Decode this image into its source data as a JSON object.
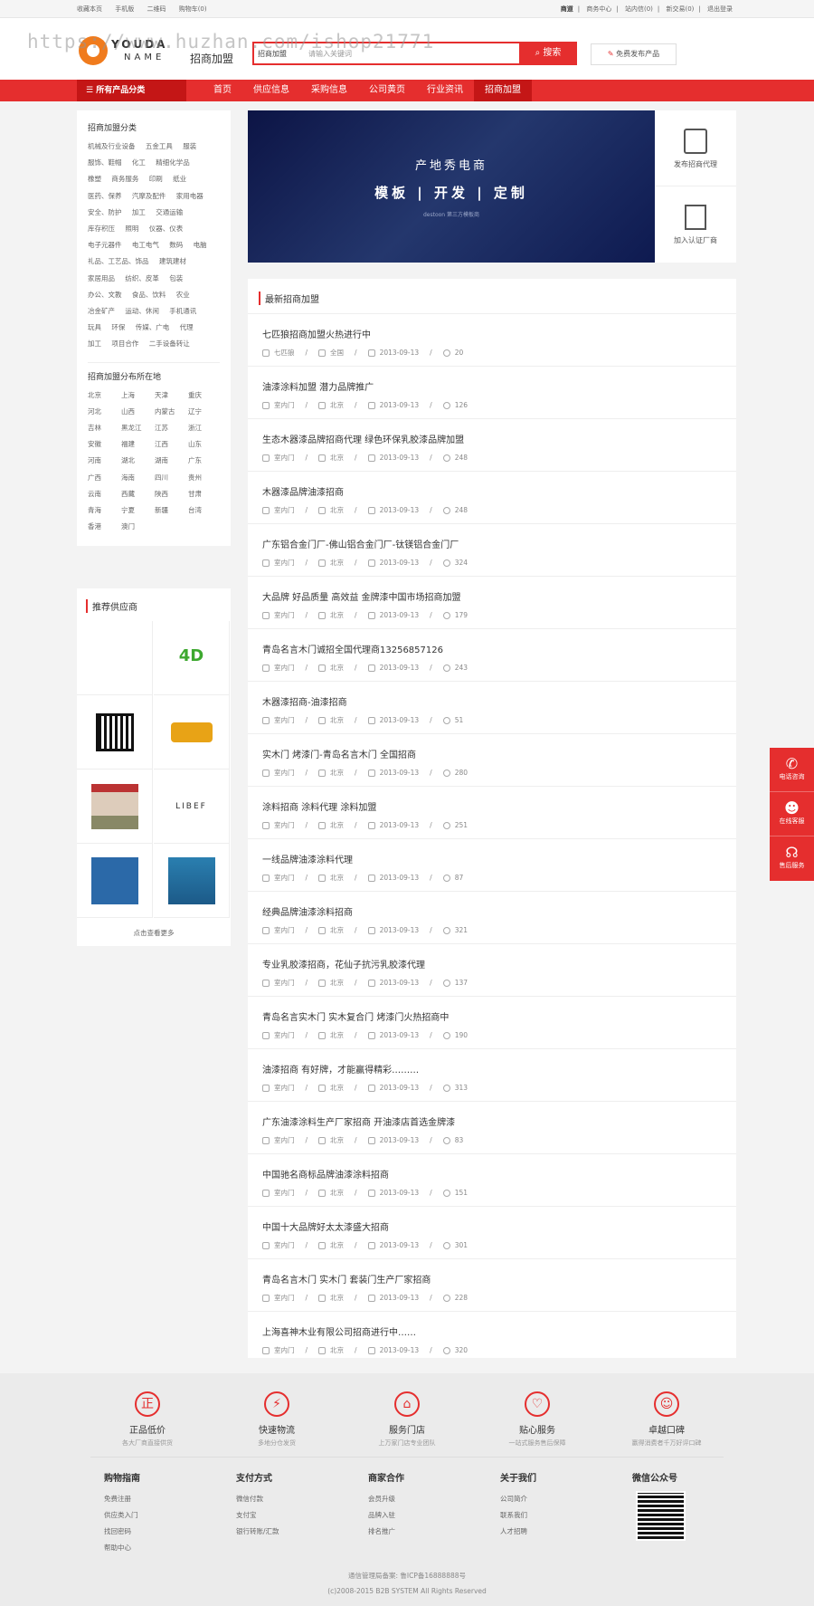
{
  "topbar": {
    "left": [
      "收藏本页",
      "手机版",
      "二维码",
      "购物车(0)"
    ],
    "right": [
      "商道",
      "商务中心",
      "站内信(0)",
      "新交易(0)",
      "退出登录"
    ]
  },
  "logo": {
    "line1": "YOUDA",
    "line2": "NAME"
  },
  "brand": "招商加盟",
  "search": {
    "category": "招商加盟",
    "placeholder": "请输入关键词",
    "button": "搜索"
  },
  "publish_button": "免费发布产品",
  "watermark": "https://www.huzhan.com/ishop21771",
  "nav": {
    "all_categories": "所有产品分类",
    "items": [
      "首页",
      "供应信息",
      "采购信息",
      "公司黄页",
      "行业资讯",
      "招商加盟"
    ],
    "active": "招商加盟"
  },
  "sidebar": {
    "categories_title": "招商加盟分类",
    "categories": [
      "机械及行业设备",
      "五金工具",
      "服装",
      "服饰、鞋帽",
      "化工",
      "精细化学品",
      "橡塑",
      "商务服务",
      "印刷",
      "纸业",
      "医药、保养",
      "汽摩及配件",
      "家用电器",
      "安全、防护",
      "加工",
      "交通运输",
      "库存积压",
      "照明",
      "仪器、仪表",
      "电子元器件",
      "电工电气",
      "数码",
      "电脑",
      "礼品、工艺品、饰品",
      "建筑建材",
      "家居用品",
      "纺织、皮革",
      "包装",
      "办公、文教",
      "食品、饮料",
      "农业",
      "冶金矿产",
      "运动、休闲",
      "手机通讯",
      "玩具",
      "环保",
      "传媒、广电",
      "代理",
      "加工",
      "项目合作",
      "二手设备转让"
    ],
    "regions_title": "招商加盟分布所在地",
    "regions": [
      "北京",
      "上海",
      "天津",
      "重庆",
      "河北",
      "山西",
      "内蒙古",
      "辽宁",
      "吉林",
      "黑龙江",
      "江苏",
      "浙江",
      "安徽",
      "福建",
      "江西",
      "山东",
      "河南",
      "湖北",
      "湖南",
      "广东",
      "广西",
      "海南",
      "四川",
      "贵州",
      "云南",
      "西藏",
      "陕西",
      "甘肃",
      "青海",
      "宁夏",
      "新疆",
      "台湾",
      "香港",
      "澳门"
    ]
  },
  "suppliers": {
    "title": "推荐供应商",
    "logo_texts": [
      "LIBEF"
    ],
    "more": "点击查看更多"
  },
  "banner": {
    "line1": "产地秀电商",
    "line2": "模板 | 开发 | 定制",
    "line3": "destoon 第三方模板商"
  },
  "banner_side": [
    "发布招商代理",
    "加入认证厂商"
  ],
  "list": {
    "title": "最新招商加盟",
    "items": [
      {
        "title": "七匹狼招商加盟火热进行中",
        "cat": "七匹狼",
        "area": "全国",
        "date": "2013-09-13",
        "views": "20"
      },
      {
        "title": "油漆涂料加盟 潜力品牌推广",
        "cat": "室内门",
        "area": "北京",
        "date": "2013-09-13",
        "views": "126"
      },
      {
        "title": "生态木器漆品牌招商代理 绿色环保乳胶漆品牌加盟",
        "cat": "室内门",
        "area": "北京",
        "date": "2013-09-13",
        "views": "248"
      },
      {
        "title": "木器漆品牌油漆招商",
        "cat": "室内门",
        "area": "北京",
        "date": "2013-09-13",
        "views": "248"
      },
      {
        "title": "广东铝合金门厂-佛山铝合金门厂-钛镁铝合金门厂",
        "cat": "室内门",
        "area": "北京",
        "date": "2013-09-13",
        "views": "324"
      },
      {
        "title": "大品牌 好品质量 高效益 金牌漆中国市场招商加盟",
        "cat": "室内门",
        "area": "北京",
        "date": "2013-09-13",
        "views": "179"
      },
      {
        "title": "青岛名言木门诚招全国代理商13256857126",
        "cat": "室内门",
        "area": "北京",
        "date": "2013-09-13",
        "views": "243"
      },
      {
        "title": "木器漆招商-油漆招商",
        "cat": "室内门",
        "area": "北京",
        "date": "2013-09-13",
        "views": "51"
      },
      {
        "title": "实木门 烤漆门-青岛名言木门 全国招商",
        "cat": "室内门",
        "area": "北京",
        "date": "2013-09-13",
        "views": "280"
      },
      {
        "title": "涂料招商 涂料代理 涂料加盟",
        "cat": "室内门",
        "area": "北京",
        "date": "2013-09-13",
        "views": "251"
      },
      {
        "title": "一线品牌油漆涂料代理",
        "cat": "室内门",
        "area": "北京",
        "date": "2013-09-13",
        "views": "87"
      },
      {
        "title": "经典品牌油漆涂料招商",
        "cat": "室内门",
        "area": "北京",
        "date": "2013-09-13",
        "views": "321"
      },
      {
        "title": "专业乳胶漆招商，花仙子抗污乳胶漆代理",
        "cat": "室内门",
        "area": "北京",
        "date": "2013-09-13",
        "views": "137"
      },
      {
        "title": "青岛名言实木门 实木复合门 烤漆门火热招商中",
        "cat": "室内门",
        "area": "北京",
        "date": "2013-09-13",
        "views": "190"
      },
      {
        "title": "油漆招商 有好牌，才能赢得精彩………",
        "cat": "室内门",
        "area": "北京",
        "date": "2013-09-13",
        "views": "313"
      },
      {
        "title": "广东油漆涂料生产厂家招商 开油漆店首选金牌漆",
        "cat": "室内门",
        "area": "北京",
        "date": "2013-09-13",
        "views": "83"
      },
      {
        "title": "中国驰名商标品牌油漆涂料招商",
        "cat": "室内门",
        "area": "北京",
        "date": "2013-09-13",
        "views": "151"
      },
      {
        "title": "中国十大品牌好太太漆盛大招商",
        "cat": "室内门",
        "area": "北京",
        "date": "2013-09-13",
        "views": "301"
      },
      {
        "title": "青岛名言木门 实木门 套装门生产厂家招商",
        "cat": "室内门",
        "area": "北京",
        "date": "2013-09-13",
        "views": "228"
      },
      {
        "title": "上海喜神木业有限公司招商进行中……",
        "cat": "室内门",
        "area": "北京",
        "date": "2013-09-13",
        "views": "320"
      }
    ]
  },
  "float": [
    "电话咨询",
    "在线客服",
    "售后服务"
  ],
  "features": [
    {
      "icon": "正",
      "name": "正品低价",
      "sub": "各大厂商直接供货"
    },
    {
      "icon": "⚡",
      "name": "快速物流",
      "sub": "多地分仓发货"
    },
    {
      "icon": "⌂",
      "name": "服务门店",
      "sub": "上万家门店专业团队"
    },
    {
      "icon": "♡",
      "name": "贴心服务",
      "sub": "一站式服务售后保障"
    },
    {
      "icon": "☺",
      "name": "卓越口碑",
      "sub": "赢得消费者千万好评口碑"
    }
  ],
  "footer_cols": [
    {
      "title": "购物指南",
      "links": [
        "免费注册",
        "供应类入门",
        "找回密码",
        "帮助中心"
      ]
    },
    {
      "title": "支付方式",
      "links": [
        "微信付款",
        "支付宝",
        "银行转账/汇款"
      ]
    },
    {
      "title": "商家合作",
      "links": [
        "会员升级",
        "品牌入驻",
        "排名推广"
      ]
    },
    {
      "title": "关于我们",
      "links": [
        "公司简介",
        "联系我们",
        "人才招聘"
      ]
    },
    {
      "title": "微信公众号",
      "links": []
    }
  ],
  "icp": "通信管理局备案: 鲁ICP备16888888号",
  "copyright": "(c)2008-2015 B2B SYSTEM All Rights Reserved"
}
